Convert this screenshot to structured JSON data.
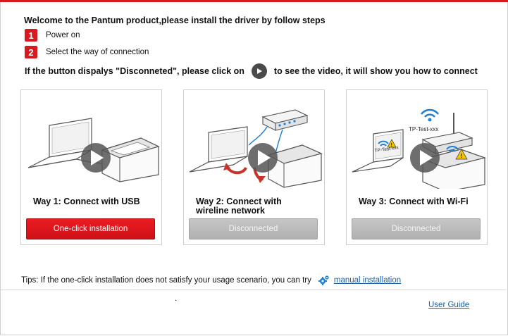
{
  "header": {
    "title": "Welcome to the Pantum product,please install the driver by follow steps"
  },
  "steps": [
    {
      "number": "1",
      "label": "Power on"
    },
    {
      "number": "2",
      "label": "Select the way of connection"
    }
  ],
  "hint": {
    "before": "If the button dispalys \"Disconneted\", please click on",
    "after": "to see the video, it will show you how to connect"
  },
  "ways": [
    {
      "label": "Way 1: Connect with USB",
      "button": "One-click installation",
      "state": "active"
    },
    {
      "label": "Way 2: Connect with wireline network",
      "button": "Disconnected",
      "state": "disabled"
    },
    {
      "label": "Way 3: Connect with Wi-Fi",
      "button": "Disconnected",
      "state": "disabled",
      "network_label": "TP-Test-xxx",
      "laptop_label": "TP-Test-xxx"
    }
  ],
  "tips": {
    "text": "Tips: If the one-click installation does not satisfy your usage scenario, you can try",
    "link": "manual installation"
  },
  "footer": {
    "dot": ".",
    "user_guide": "User Guide"
  },
  "colors": {
    "accent": "#d71920",
    "disabled": "#b8b8b8",
    "link": "#1b5fa8"
  },
  "icons": [
    "play-icon",
    "gear-icon",
    "wifi-icon",
    "warning-icon"
  ]
}
